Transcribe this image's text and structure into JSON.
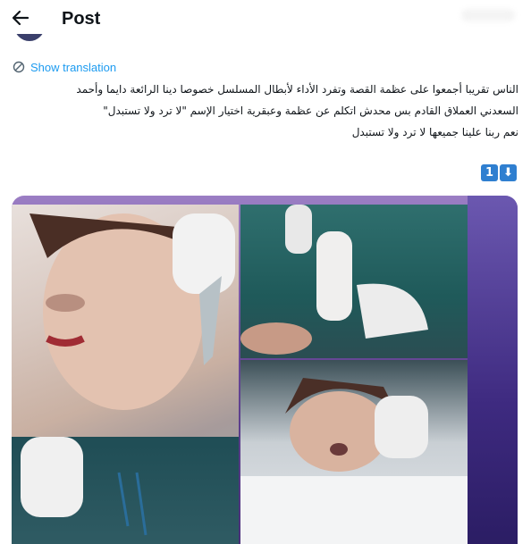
{
  "header": {
    "title": "Post",
    "back_icon": "arrow-left-icon"
  },
  "translation": {
    "label": "Show translation",
    "icon": "translate-icon",
    "color": "#1d9bf0"
  },
  "post": {
    "lines": [
      "الناس تقريبا أجمعوا على عظمة القصة وتفرد الأداء لأبطال المسلسل خصوصا دينا الرائعة دايما وأحمد",
      "السعدني العملاق القادم بس محدش اتكلم عن عظمة وعبقرية اختيار الإسم \"لا ترد ولا تستبدل\"",
      "نعم ربنا علينا جميعها لا ترد ولا تستبدل"
    ],
    "emoji": [
      "1",
      "⬇"
    ]
  },
  "media": {
    "description_icon": "photo-collage",
    "accent": "#5a3f8e"
  }
}
